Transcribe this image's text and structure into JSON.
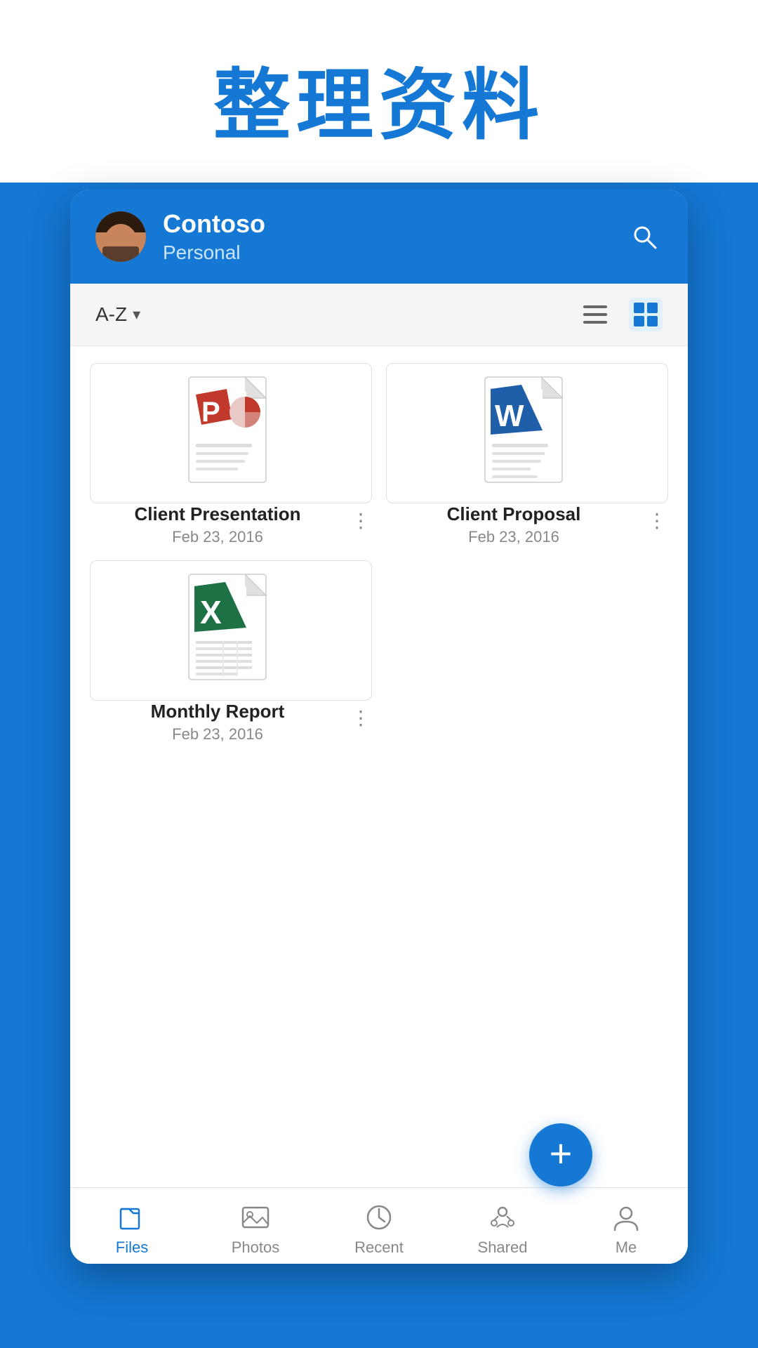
{
  "page": {
    "title": "整理资料",
    "bg_color": "#1478D4"
  },
  "header": {
    "account_name": "Contoso",
    "account_sub": "Personal",
    "search_label": "search"
  },
  "toolbar": {
    "sort_label": "A-Z",
    "sort_icon": "chevron-down",
    "list_view_label": "list view",
    "grid_view_label": "grid view"
  },
  "files": [
    {
      "id": "file-1",
      "name": "Client Presentation",
      "date": "Feb 23, 2016",
      "type": "pptx",
      "icon_color": "#C0392B"
    },
    {
      "id": "file-2",
      "name": "Client Proposal",
      "date": "Feb 23, 2016",
      "type": "docx",
      "icon_color": "#1F5EA8"
    },
    {
      "id": "file-3",
      "name": "Monthly Report",
      "date": "Feb 23, 2016",
      "type": "xlsx",
      "icon_color": "#1E7145"
    }
  ],
  "bottom_nav": [
    {
      "id": "nav-files",
      "label": "Files",
      "active": true
    },
    {
      "id": "nav-photos",
      "label": "Photos",
      "active": false
    },
    {
      "id": "nav-recent",
      "label": "Recent",
      "active": false
    },
    {
      "id": "nav-shared",
      "label": "Shared",
      "active": false
    },
    {
      "id": "nav-me",
      "label": "Me",
      "active": false
    }
  ],
  "fab": {
    "label": "add"
  }
}
